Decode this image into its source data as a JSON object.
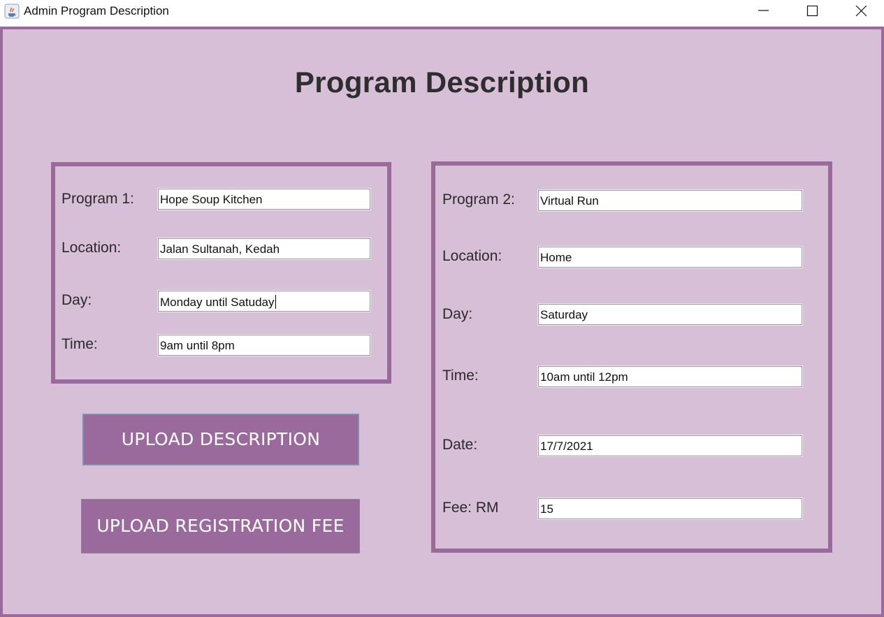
{
  "window": {
    "title": "Admin Program Description"
  },
  "heading": "Program Description",
  "program1": {
    "labels": {
      "program": "Program 1:",
      "location": "Location:",
      "day": "Day:",
      "time": "Time:"
    },
    "values": {
      "program": "Hope Soup Kitchen",
      "location": "Jalan Sultanah, Kedah",
      "day": "Monday until Satuday",
      "time": "9am until 8pm"
    }
  },
  "program2": {
    "labels": {
      "program": "Program 2:",
      "location": "Location:",
      "day": "Day:",
      "time": "Time:",
      "date": "Date:",
      "fee": "Fee: RM"
    },
    "values": {
      "program": "Virtual Run",
      "location": "Home",
      "day": "Saturday",
      "time": "10am until 12pm",
      "date": "17/7/2021",
      "fee": "15"
    }
  },
  "buttons": {
    "upload_description": "UPLOAD DESCRIPTION",
    "upload_registration_fee": "UPLOAD REGISTRATION FEE"
  },
  "colors": {
    "background": "#d7bfd8",
    "accent": "#9a6a9c",
    "button_text": "#ffffff"
  },
  "icons": {
    "app": "java-coffee-cup-icon",
    "minimize": "minimize-icon",
    "maximize": "maximize-icon",
    "close": "close-icon"
  }
}
